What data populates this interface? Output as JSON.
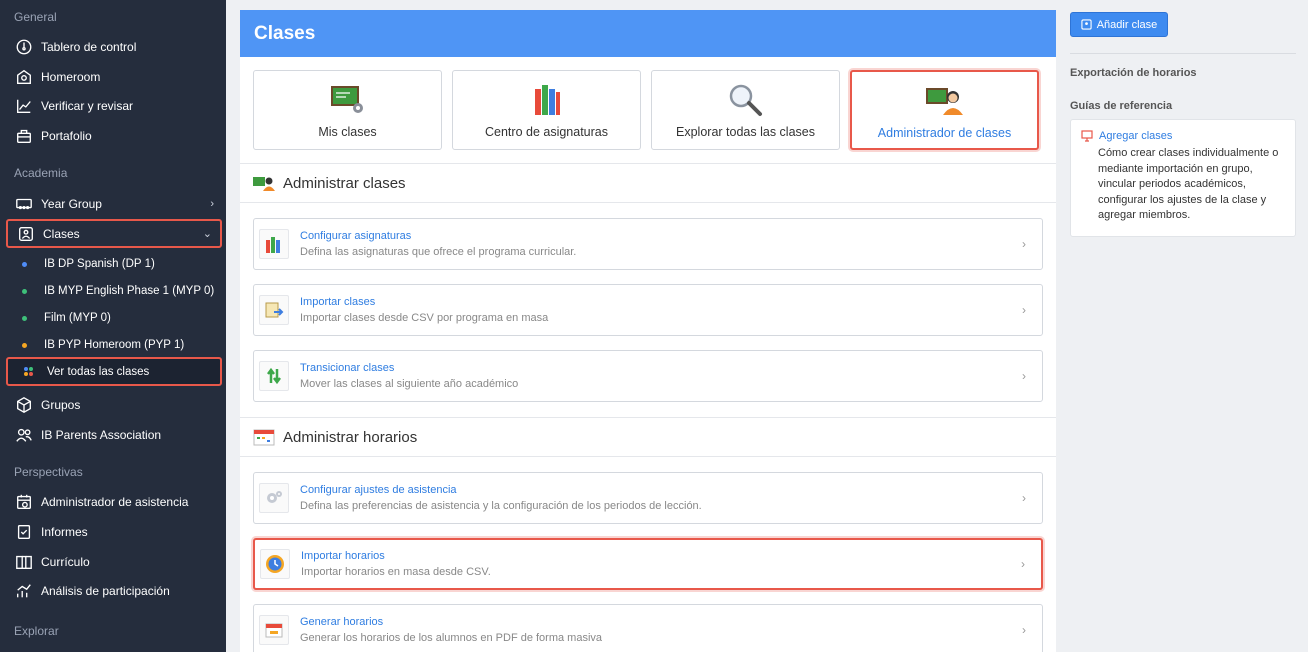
{
  "sidebar": {
    "sections": {
      "general": "General",
      "academia": "Academia",
      "perspectivas": "Perspectivas",
      "explorar": "Explorar"
    },
    "general_items": [
      "Tablero de control",
      "Homeroom",
      "Verificar y revisar",
      "Portafolio"
    ],
    "academia_items": {
      "year_group": "Year Group",
      "clases": "Clases",
      "sub": [
        "IB DP Spanish (DP 1)",
        "IB MYP English Phase 1 (MYP 0)",
        "Film (MYP 0)",
        "IB PYP Homeroom (PYP 1)"
      ],
      "ver_todas": "Ver todas las clases",
      "grupos": "Grupos",
      "parents": "IB Parents Association"
    },
    "perspectivas_items": [
      "Administrador de asistencia",
      "Informes",
      "Currículo",
      "Análisis de participación"
    ],
    "dot_colors": [
      "#4f8cf7",
      "#3ec07a",
      "#3ec07a",
      "#f5a623"
    ]
  },
  "main": {
    "title": "Clases",
    "cards": [
      "Mis clases",
      "Centro de asignaturas",
      "Explorar todas las clases",
      "Administrador de clases"
    ],
    "section1": "Administrar clases",
    "rows1": [
      {
        "title": "Configurar asignaturas",
        "desc": "Defina las asignaturas que ofrece el programa curricular."
      },
      {
        "title": "Importar clases",
        "desc": "Importar clases desde CSV por programa en masa"
      },
      {
        "title": "Transicionar clases",
        "desc": "Mover las clases al siguiente año académico"
      }
    ],
    "section2": "Administrar horarios",
    "rows2": [
      {
        "title": "Configurar ajustes de asistencia",
        "desc": "Defina las preferencias de asistencia y la configuración de los periodos de lección."
      },
      {
        "title": "Importar horarios",
        "desc": "Importar horarios en masa desde CSV."
      },
      {
        "title": "Generar horarios",
        "desc": "Generar los horarios de los alumnos en PDF de forma masiva"
      }
    ]
  },
  "right": {
    "add_button": "Añadir clase",
    "export_title": "Exportación de horarios",
    "guides_title": "Guías de referencia",
    "guide_link": "Agregar clases",
    "guide_desc": "Cómo crear clases individualmente o mediante importación en grupo, vincular periodos académicos, configurar los ajustes de la clase y agregar miembros."
  },
  "colors": {
    "accent": "#4f95f5",
    "highlight": "#e8584a",
    "sidebar_bg": "#252d3d",
    "link": "#2f7de1"
  }
}
